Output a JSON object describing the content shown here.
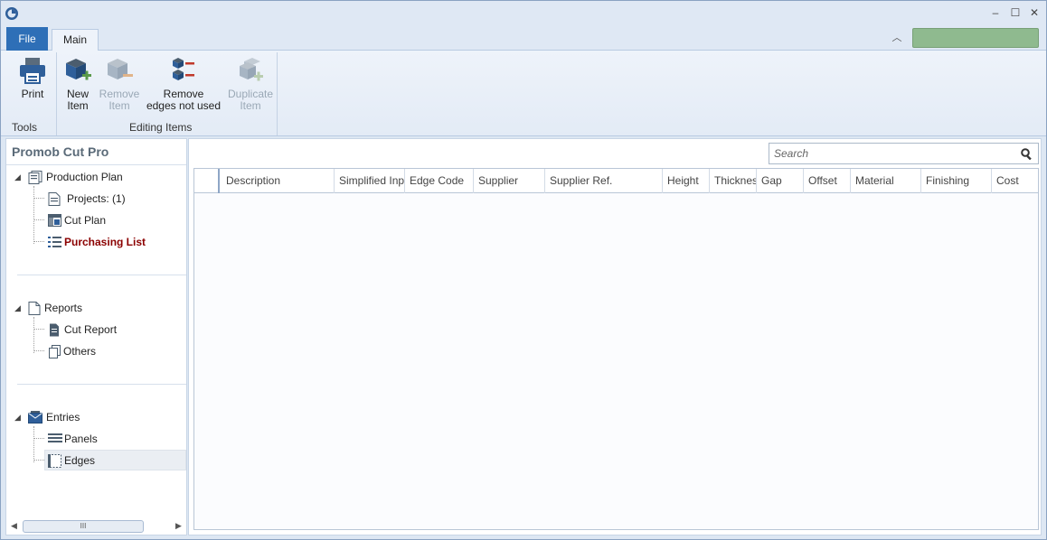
{
  "window": {
    "controls": [
      "–",
      "☐",
      "✕"
    ]
  },
  "ribbon_tabs": {
    "file": "File",
    "main": "Main",
    "collapse": "︿"
  },
  "ribbon": {
    "groups": [
      {
        "label": "Tools",
        "buttons": [
          {
            "line1": "Print",
            "line2": "",
            "enabled": true,
            "icon": "printer-icon"
          }
        ]
      },
      {
        "label": "Editing Items",
        "buttons": [
          {
            "line1": "New",
            "line2": "Item",
            "enabled": true,
            "icon": "new-item-icon"
          },
          {
            "line1": "Remove",
            "line2": "Item",
            "enabled": false,
            "icon": "remove-item-icon"
          },
          {
            "line1": "Remove",
            "line2": "edges not used",
            "enabled": true,
            "icon": "remove-edges-icon"
          },
          {
            "line1": "Duplicate",
            "line2": "Item",
            "enabled": false,
            "icon": "duplicate-item-icon"
          }
        ]
      }
    ]
  },
  "nav": {
    "title": "Promob Cut Pro",
    "sections": [
      {
        "label": "Production Plan",
        "icon": "production-plan-icon",
        "children": [
          {
            "label": "Projects: (1)",
            "icon": "document-icon"
          },
          {
            "label": "Cut Plan",
            "icon": "cut-plan-icon"
          },
          {
            "label": "Purchasing List",
            "icon": "list-icon",
            "active": true
          }
        ]
      },
      {
        "label": "Reports",
        "icon": "report-icon",
        "children": [
          {
            "label": "Cut Report",
            "icon": "cut-report-icon"
          },
          {
            "label": "Others",
            "icon": "copy-pages-icon"
          }
        ]
      },
      {
        "label": "Entries",
        "icon": "entries-icon",
        "children": [
          {
            "label": "Panels",
            "icon": "panels-icon"
          },
          {
            "label": "Edges",
            "icon": "edges-icon",
            "selected": true
          }
        ]
      }
    ],
    "scroll_thumb": "III"
  },
  "search": {
    "placeholder": "Search"
  },
  "grid": {
    "columns": [
      "Description",
      "Simplified Inp",
      "Edge Code",
      "Supplier",
      "Supplier Ref.",
      "Height",
      "Thicknes",
      "Gap",
      "Offset",
      "Material",
      "Finishing",
      "Cost"
    ]
  },
  "colors": {
    "accent": "#2e6fb7",
    "active_nav": "#8b0000",
    "user_box": "#8fba8f"
  }
}
